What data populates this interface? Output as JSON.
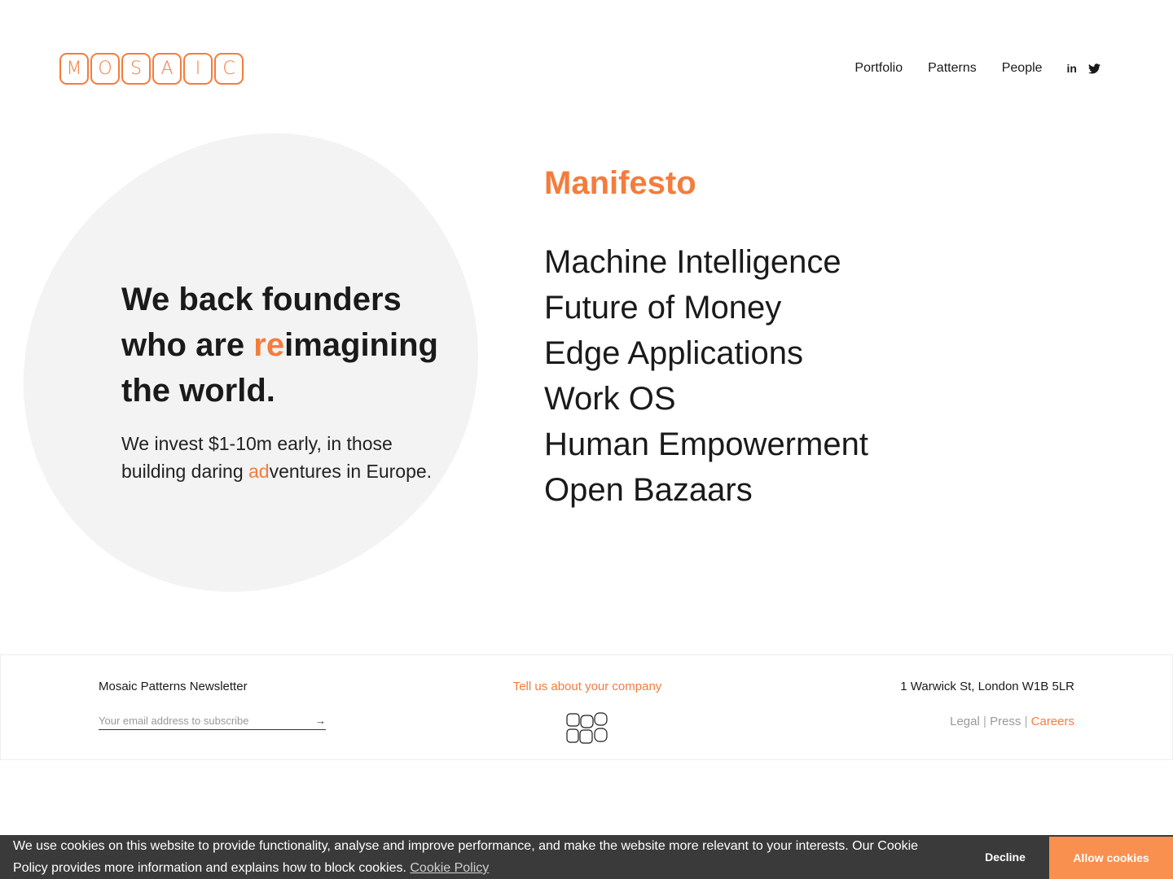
{
  "header": {
    "logo_letters": [
      "M",
      "O",
      "S",
      "A",
      "I",
      "C"
    ],
    "nav": [
      {
        "label": "Portfolio"
      },
      {
        "label": "Patterns"
      },
      {
        "label": "People"
      }
    ],
    "social": {
      "linkedin": "in",
      "twitter": "twitter-icon"
    }
  },
  "hero": {
    "title_part1": "We back founders who are ",
    "title_accent": "re",
    "title_part2": "imagining the world.",
    "sub_part1": "We invest $1-10m early, in those building daring ",
    "sub_accent": "ad",
    "sub_part2": "ventures in Europe."
  },
  "manifesto": {
    "title": "Manifesto",
    "items": [
      "Machine Intelligence",
      "Future of Money",
      "Edge Applications",
      "Work OS",
      "Human Empowerment",
      "Open Bazaars"
    ]
  },
  "footer": {
    "newsletter_title": "Mosaic Patterns Newsletter",
    "newsletter_placeholder": "Your email address to subscribe",
    "tell_us": "Tell us about your company",
    "address": "1 Warwick St, London W1B 5LR",
    "links": {
      "legal": "Legal",
      "press": "Press",
      "careers": "Careers",
      "separator": " | "
    }
  },
  "cookie": {
    "text": "We use cookies on this website to provide functionality, analyse and improve performance, and make the website more relevant to your interests. Our Cookie Policy provides more information and explains how to block cookies.",
    "link": "Cookie Policy",
    "decline": "Decline",
    "allow": "Allow cookies"
  },
  "colors": {
    "accent": "#f47c3c",
    "blob": "#f3f3f3",
    "cookie_bg": "#3a3a3a",
    "allow_bg": "#f9904f"
  }
}
